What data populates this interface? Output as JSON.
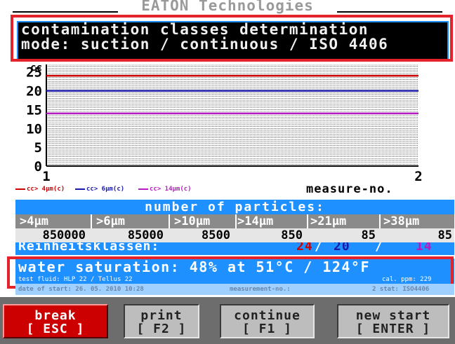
{
  "brand": "EATON Technologies",
  "header": {
    "line1": "contamination classes determination",
    "line2": "mode: suction / continuous / ISO 4406"
  },
  "chart_data": {
    "type": "line",
    "ylabel": "cc",
    "xlabel": "measure-no.",
    "yticks": [
      0,
      5,
      10,
      15,
      20,
      25
    ],
    "xticks": [
      1,
      2
    ],
    "ylim": [
      0,
      27
    ],
    "xlim": [
      1,
      2
    ],
    "grid": true,
    "series": [
      {
        "name": "cc> 4µm(c)",
        "color": "#cc0000",
        "values": [
          24,
          24
        ]
      },
      {
        "name": "cc> 6µm(c)",
        "color": "#1a1aa8",
        "values": [
          20,
          20
        ]
      },
      {
        "name": "cc> 14µm(c)",
        "color": "#b51cc0",
        "values": [
          14,
          14
        ]
      }
    ]
  },
  "legend": {
    "items": [
      {
        "label": "cc> 4µm(c)",
        "color": "#cc0000"
      },
      {
        "label": "cc> 6µm(c)",
        "color": "#1a1aa8"
      },
      {
        "label": "cc> 14µm(c)",
        "color": "#b51cc0"
      }
    ]
  },
  "measure_label": "measure-no.",
  "particles": {
    "title": "number of particles:",
    "sizes": [
      ">4µm",
      ">6µm",
      ">10µm",
      ">14µm",
      ">21µm",
      ">38µm"
    ],
    "counts": [
      "850000",
      "85000",
      "8500",
      "850",
      "85",
      "85"
    ]
  },
  "classes": {
    "label": "Reinheitsklassen:",
    "c4": "24",
    "c6": "20",
    "c14": "14",
    "sep": "/"
  },
  "water": {
    "text": "water saturation: 48% at  51°C / 124°F",
    "fluid": "test fluid: HLP 22 / Tellus 22",
    "cal": "cal. ppm: 229"
  },
  "status": {
    "date": "date of start: 26. 05. 2010 10:28",
    "measure": "measurement-no.:",
    "stat": "2  stat: ISO4406"
  },
  "buttons": [
    {
      "title": "break",
      "key": "[ ESC ]",
      "style": "red"
    },
    {
      "title": "print",
      "key": "[ F2 ]",
      "style": "grey"
    },
    {
      "title": "continue",
      "key": "[ F1 ]",
      "style": "grey"
    },
    {
      "title": "new start",
      "key": "[ ENTER ]",
      "style": "grey"
    }
  ],
  "colors": {
    "accent": "#1e90ff",
    "highlight": "#e4222c"
  }
}
